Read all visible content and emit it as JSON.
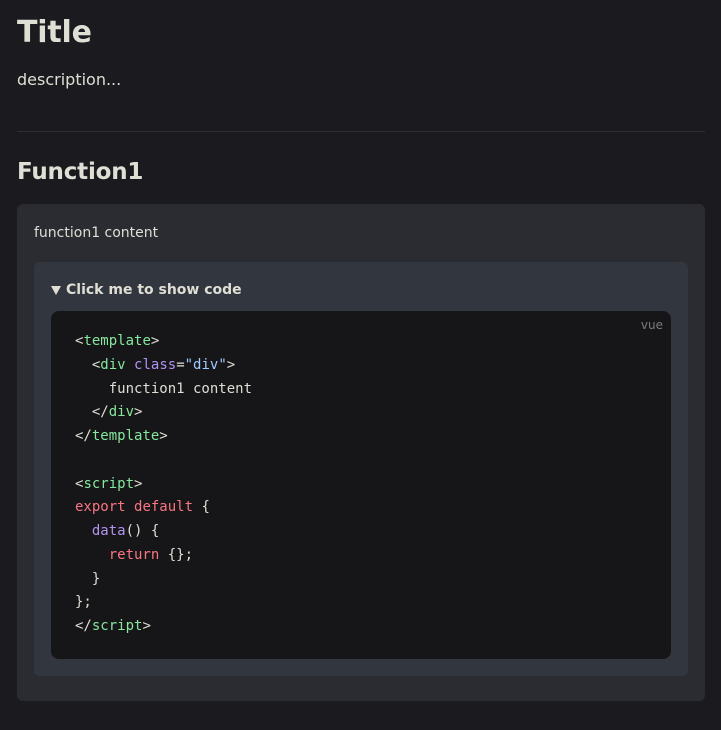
{
  "page": {
    "title": "Title",
    "description": "description..."
  },
  "section": {
    "heading": "Function1",
    "demo_content": "function1 content",
    "toggle_label": "Click me to show code",
    "code_language": "vue",
    "code_lines": [
      [
        {
          "t": "plain",
          "v": "<"
        },
        {
          "t": "tag",
          "v": "template"
        },
        {
          "t": "plain",
          "v": ">"
        }
      ],
      [
        {
          "t": "plain",
          "v": "  <"
        },
        {
          "t": "tag",
          "v": "div"
        },
        {
          "t": "plain",
          "v": " "
        },
        {
          "t": "attr",
          "v": "class"
        },
        {
          "t": "plain",
          "v": "="
        },
        {
          "t": "str",
          "v": "\"div\""
        },
        {
          "t": "plain",
          "v": ">"
        }
      ],
      [
        {
          "t": "plain",
          "v": "    function1 content"
        }
      ],
      [
        {
          "t": "plain",
          "v": "  </"
        },
        {
          "t": "tag",
          "v": "div"
        },
        {
          "t": "plain",
          "v": ">"
        }
      ],
      [
        {
          "t": "plain",
          "v": "</"
        },
        {
          "t": "tag",
          "v": "template"
        },
        {
          "t": "plain",
          "v": ">"
        }
      ],
      [
        {
          "t": "plain",
          "v": ""
        }
      ],
      [
        {
          "t": "plain",
          "v": "<"
        },
        {
          "t": "tag",
          "v": "script"
        },
        {
          "t": "plain",
          "v": ">"
        }
      ],
      [
        {
          "t": "kw",
          "v": "export"
        },
        {
          "t": "plain",
          "v": " "
        },
        {
          "t": "kw",
          "v": "default"
        },
        {
          "t": "plain",
          "v": " {"
        }
      ],
      [
        {
          "t": "plain",
          "v": "  "
        },
        {
          "t": "fn",
          "v": "data"
        },
        {
          "t": "plain",
          "v": "() {"
        }
      ],
      [
        {
          "t": "plain",
          "v": "    "
        },
        {
          "t": "kw",
          "v": "return"
        },
        {
          "t": "plain",
          "v": " {};"
        }
      ],
      [
        {
          "t": "plain",
          "v": "  }"
        }
      ],
      [
        {
          "t": "plain",
          "v": "};"
        }
      ],
      [
        {
          "t": "plain",
          "v": "</"
        },
        {
          "t": "tag",
          "v": "script"
        },
        {
          "t": "plain",
          "v": ">"
        }
      ]
    ]
  },
  "colors": {
    "background": "#1b1b1f",
    "card": "#2a2c31",
    "code_panel": "#32363e",
    "code_bg": "#161618",
    "tag": "#85e89d",
    "attr": "#b392f0",
    "string": "#9ecbff",
    "keyword": "#f97583"
  },
  "icons": {
    "toggle": "triangle-down-icon"
  }
}
